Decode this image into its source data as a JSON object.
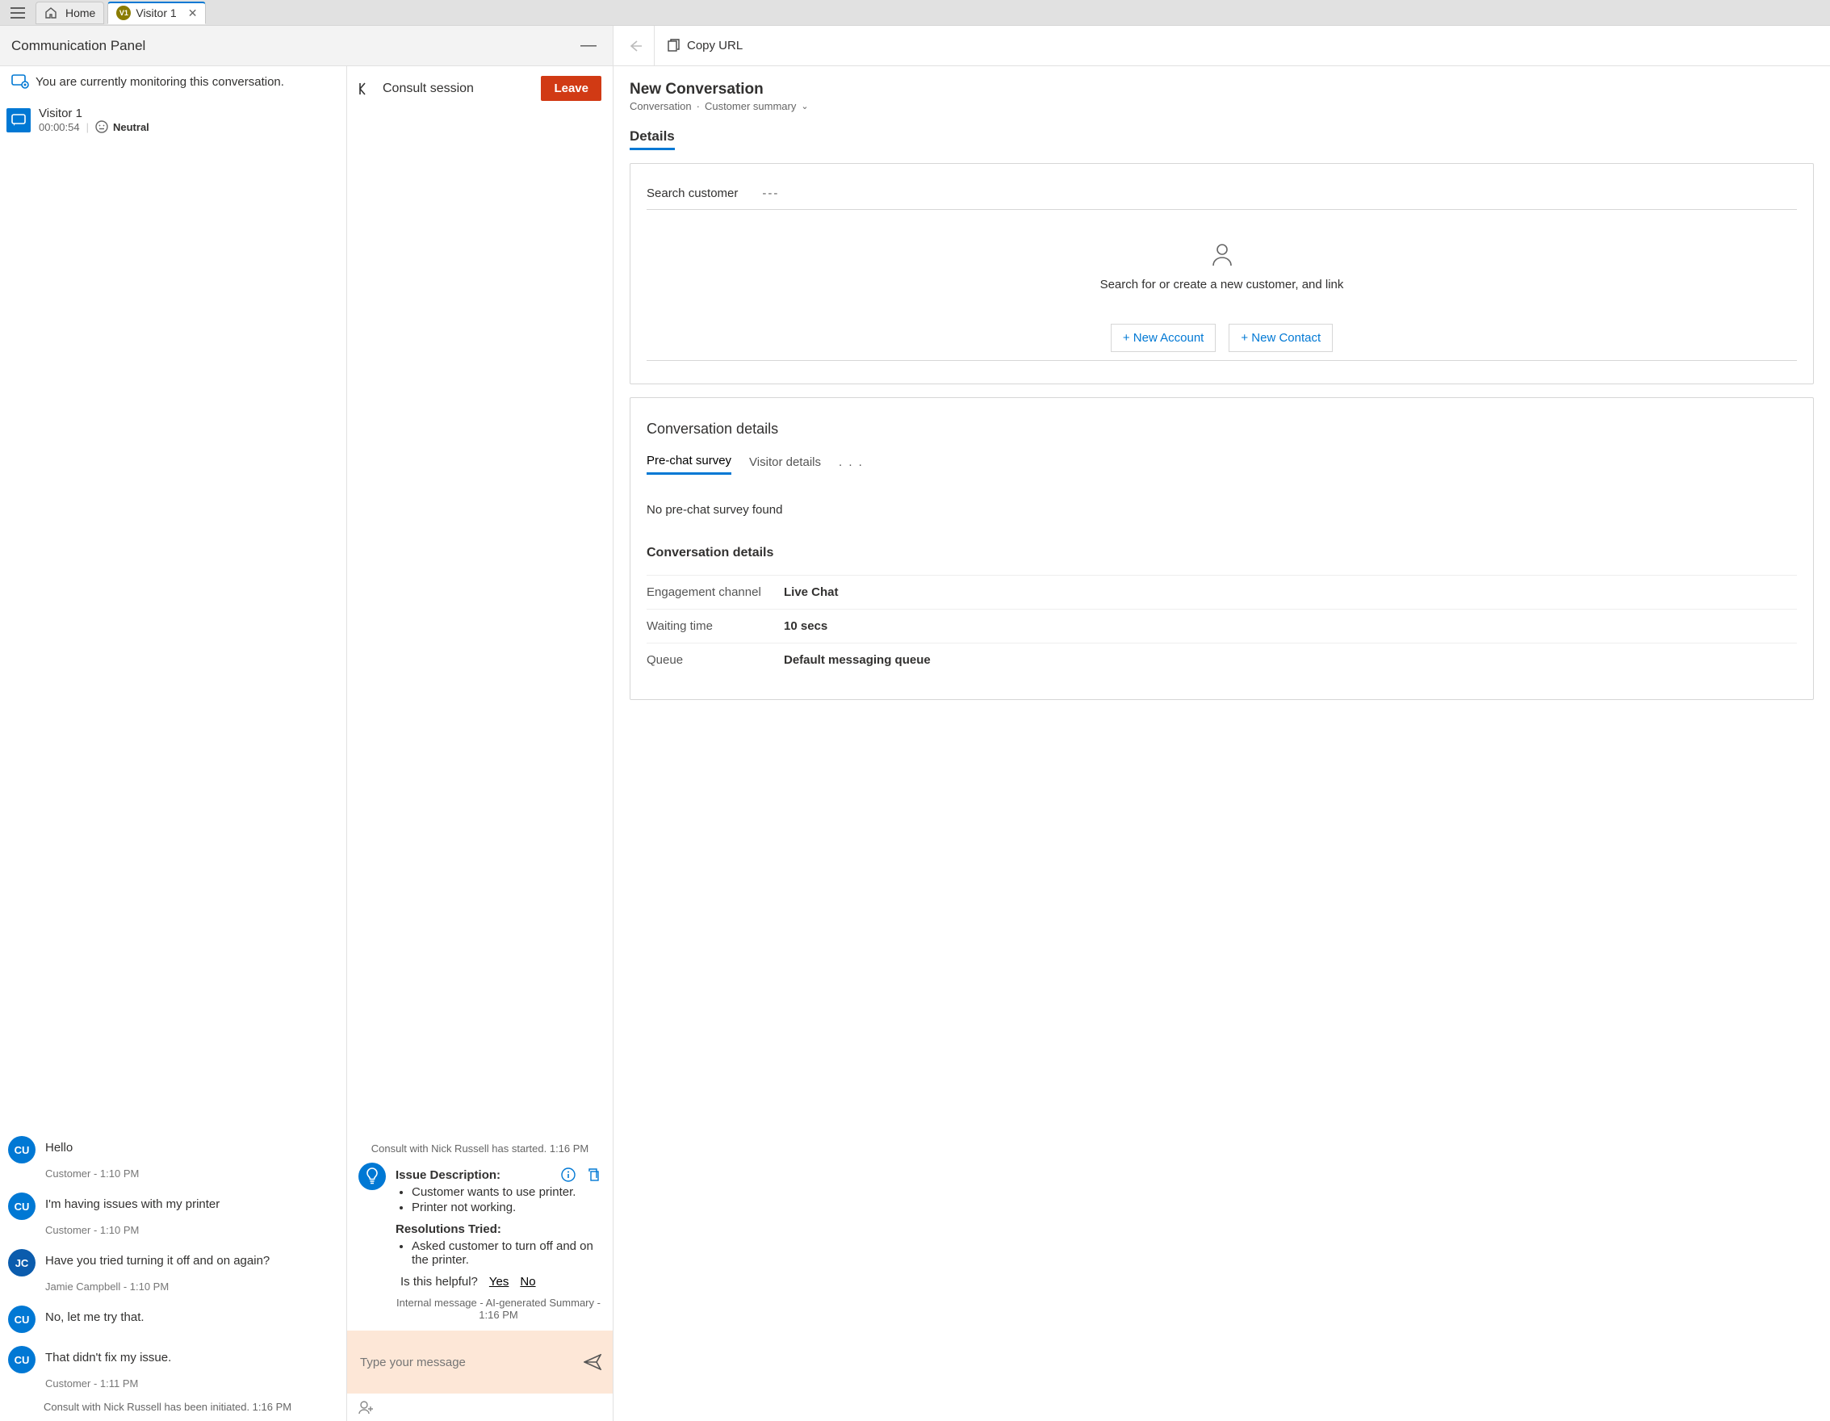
{
  "tabbar": {
    "home_label": "Home",
    "visitor_tab": {
      "badge": "V1",
      "label": "Visitor 1"
    }
  },
  "comm_panel": {
    "title": "Communication Panel",
    "monitor_notice": "You are currently monitoring this conversation.",
    "session": {
      "name": "Visitor 1",
      "timer": "00:00:54",
      "sentiment": "Neutral"
    }
  },
  "chat": {
    "messages": [
      {
        "avatar": "CU",
        "text": "Hello",
        "meta": "Customer - 1:10 PM"
      },
      {
        "avatar": "CU",
        "text": "I'm having issues with my printer",
        "meta": "Customer - 1:10 PM"
      },
      {
        "avatar": "JC",
        "text": "Have you tried turning it off and on again?",
        "meta": "Jamie Campbell - 1:10 PM"
      },
      {
        "avatar": "CU",
        "text": "No, let me try that.",
        "meta": ""
      },
      {
        "avatar": "CU",
        "text": "That didn't fix my issue.",
        "meta": "Customer - 1:11 PM"
      }
    ],
    "system_note": "Consult with Nick Russell has been initiated. 1:16 PM"
  },
  "consult": {
    "title": "Consult session",
    "leave_label": "Leave",
    "system_start": "Consult with Nick Russell has started. 1:16 PM",
    "ai": {
      "issue_title": "Issue Description:",
      "issue_items": [
        "Customer wants to use printer.",
        "Printer not working."
      ],
      "res_title": "Resolutions Tried:",
      "res_items": [
        "Asked customer to turn off and on the printer."
      ],
      "helpful_q": "Is this helpful?",
      "yes": "Yes",
      "no": "No",
      "meta": "Internal message - AI-generated Summary - 1:16 PM"
    },
    "input_placeholder": "Type your message"
  },
  "details": {
    "copy_url": "Copy URL",
    "new_conversation": "New Conversation",
    "breadcrumb_a": "Conversation",
    "breadcrumb_b": "Customer summary",
    "details_tab": "Details",
    "search_customer_label": "Search customer",
    "search_dash": "---",
    "empty_text": "Search for or create a new customer, and link",
    "new_account": "+ New Account",
    "new_contact": "+ New Contact",
    "conv_details_title": "Conversation details",
    "tabs": {
      "pre": "Pre-chat survey",
      "vis": "Visitor details",
      "more": ". . ."
    },
    "no_survey": "No pre-chat survey found",
    "kv_title": "Conversation details",
    "kv": {
      "engagement_k": "Engagement channel",
      "engagement_v": "Live Chat",
      "waiting_k": "Waiting time",
      "waiting_v": "10 secs",
      "queue_k": "Queue",
      "queue_v": "Default messaging queue"
    }
  }
}
